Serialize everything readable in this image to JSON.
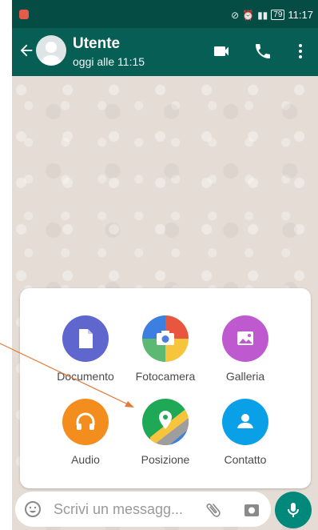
{
  "status_bar": {
    "time": "11:17",
    "battery": "79"
  },
  "header": {
    "contact_name": "Utente",
    "last_seen": "oggi alle 11:15"
  },
  "attachments": [
    {
      "label": "Documento",
      "icon": "document-icon",
      "color": "#5f66cd"
    },
    {
      "label": "Fotocamera",
      "icon": "camera-icon",
      "color": "#e8563f"
    },
    {
      "label": "Galleria",
      "icon": "gallery-icon",
      "color": "#bf59cf"
    },
    {
      "label": "Audio",
      "icon": "headphones-icon",
      "color": "#f28d1e"
    },
    {
      "label": "Posizione",
      "icon": "location-icon",
      "color": "#1fa855"
    },
    {
      "label": "Contatto",
      "icon": "contact-icon",
      "color": "#0aa0e8"
    }
  ],
  "composer": {
    "placeholder": "Scrivi un messagg..."
  },
  "colors": {
    "primary": "#075e54",
    "status_bar": "#054d44",
    "accent": "#00897b",
    "annotation_arrow": "#e07b39"
  }
}
